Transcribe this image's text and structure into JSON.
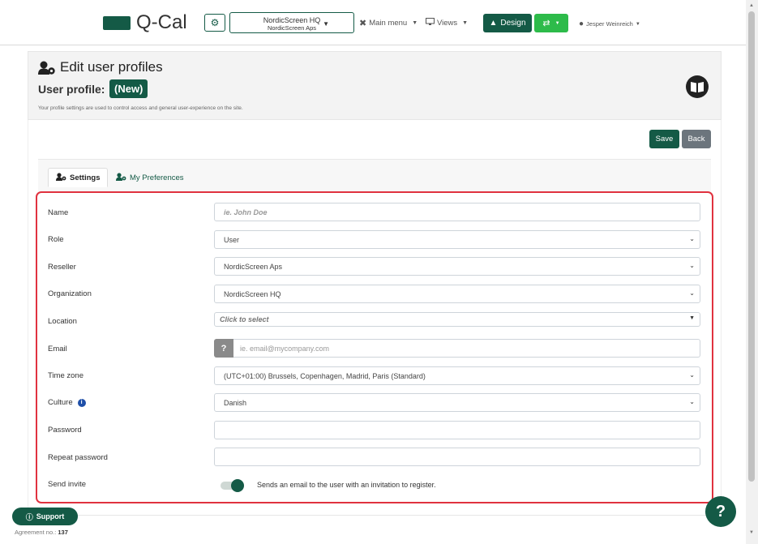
{
  "app": {
    "logo_text": "Q-Cal"
  },
  "topbar": {
    "org_select": {
      "line1": "NordicScreen HQ",
      "line2": "NordicScreen Aps"
    },
    "main_menu_label": "Main menu",
    "views_label": "Views",
    "design_label": "Design",
    "user_name": "Jesper Weinreich"
  },
  "header": {
    "title": "Edit user profiles",
    "subtitle": "User profile:",
    "badge": "(New)",
    "description": "Your profile settings are used to control access and general user-experience on the site."
  },
  "actions": {
    "save": "Save",
    "back": "Back"
  },
  "tabs": [
    {
      "label": "Settings",
      "active": true
    },
    {
      "label": "My Preferences",
      "active": false
    }
  ],
  "form": {
    "name": {
      "label": "Name",
      "placeholder": "ie. John Doe"
    },
    "role": {
      "label": "Role",
      "value": "User"
    },
    "reseller": {
      "label": "Reseller",
      "value": "NordicScreen Aps"
    },
    "organization": {
      "label": "Organization",
      "value": "NordicScreen HQ"
    },
    "location": {
      "label": "Location",
      "placeholder": "Click to select"
    },
    "email": {
      "label": "Email",
      "placeholder": "ie. email@mycompany.com",
      "help_glyph": "?"
    },
    "timezone": {
      "label": "Time zone",
      "value": "(UTC+01:00) Brussels, Copenhagen, Madrid, Paris (Standard)"
    },
    "culture": {
      "label": "Culture",
      "value": "Danish",
      "info_glyph": "i"
    },
    "password": {
      "label": "Password"
    },
    "repeat_password": {
      "label": "Repeat password"
    },
    "send_invite": {
      "label": "Send invite",
      "enabled": true,
      "description": "Sends an email to the user with an invitation to register."
    }
  },
  "footer": {
    "support_label": "Support",
    "agreement_label": "Agreement no.:",
    "agreement_no": "137",
    "help_glyph": "?"
  },
  "colors": {
    "brand": "#145a46",
    "accent_green": "#2dbb4a",
    "highlight": "#e0323f"
  }
}
